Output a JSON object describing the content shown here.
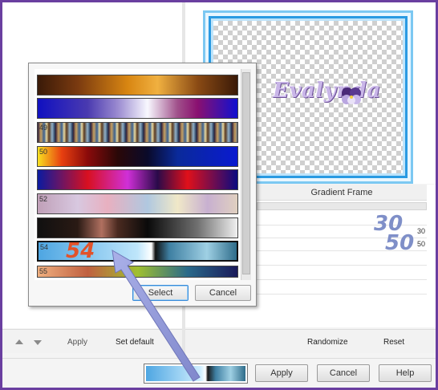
{
  "preview": {
    "watermark_text": "Evalynda"
  },
  "settings": {
    "section_title": "Gradient Frame",
    "value_a": "30",
    "value_b": "50",
    "annotation_a": "30",
    "annotation_b": "50"
  },
  "left_toolbar": {
    "apply_label": "Apply",
    "set_default_label": "Set default"
  },
  "right_toolbar": {
    "randomize_label": "Randomize",
    "reset_label": "Reset"
  },
  "bottom": {
    "apply_label": "Apply",
    "cancel_label": "Cancel",
    "help_label": "Help"
  },
  "picker": {
    "swatches": [
      {
        "label": ""
      },
      {
        "label": ""
      },
      {
        "label": "49"
      },
      {
        "label": "50"
      },
      {
        "label": ""
      },
      {
        "label": "52"
      },
      {
        "label": ""
      },
      {
        "label": "54"
      },
      {
        "label": "55"
      }
    ],
    "selected_annotation": "54",
    "select_label": "Select",
    "cancel_label": "Cancel"
  },
  "colors": {
    "frame_border": "#6a3fa0",
    "annotation_blue": "#7f8fc8",
    "annotation_red": "#e2522a",
    "arrow": "#8f96d6"
  }
}
